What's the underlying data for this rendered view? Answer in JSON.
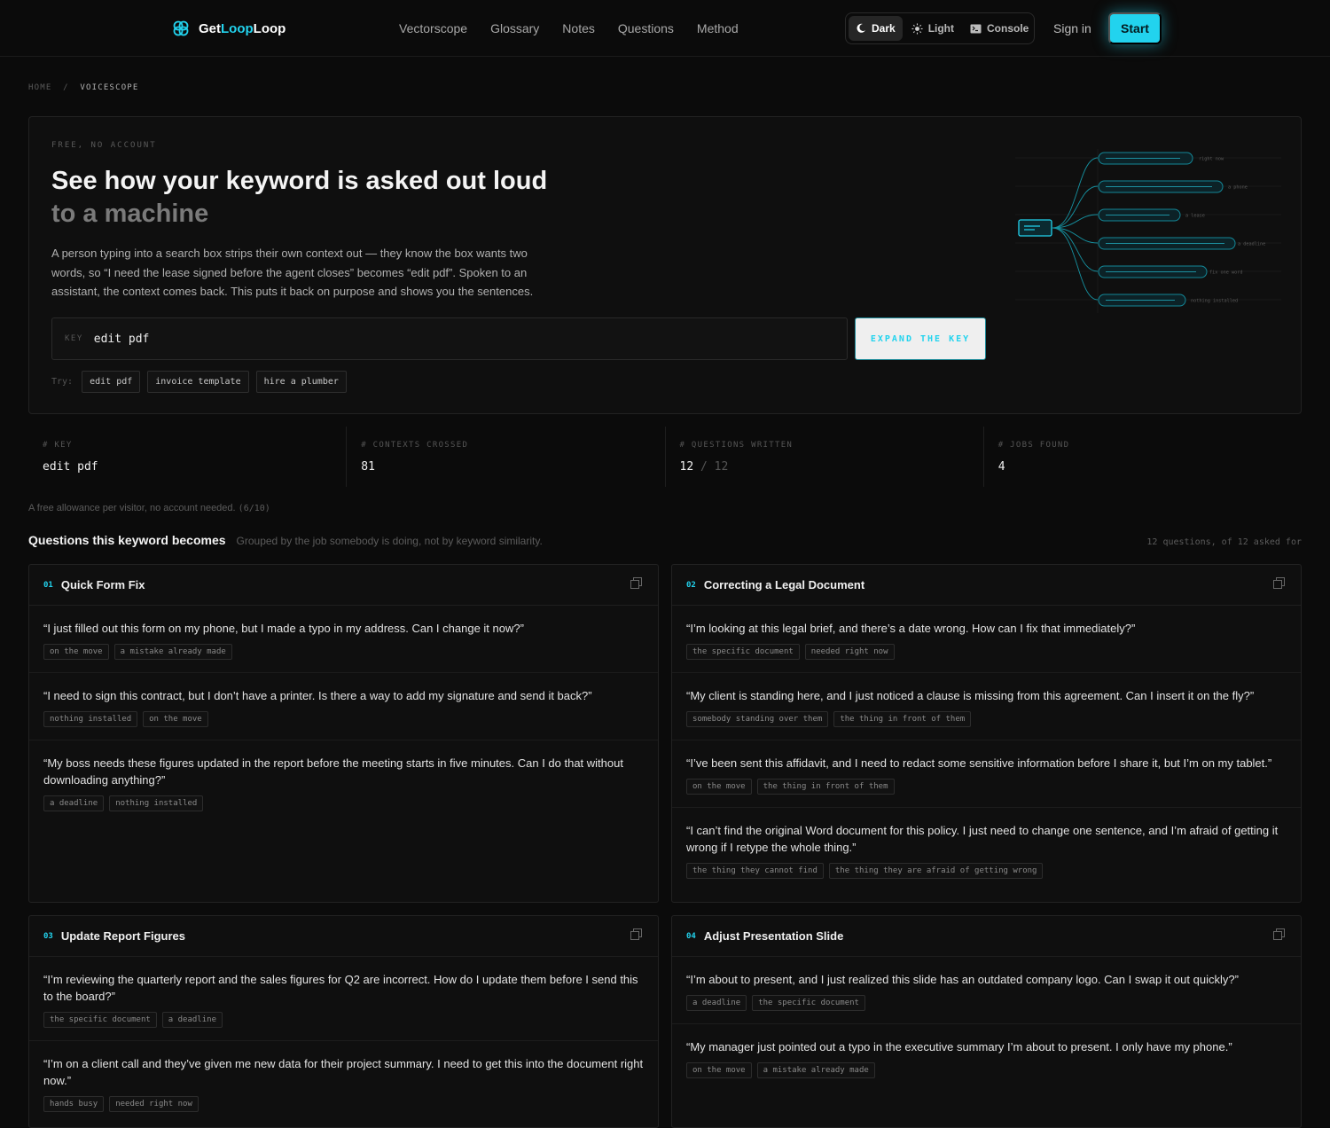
{
  "nav": {
    "brand_get": "Get",
    "brand_loop": "Loop",
    "brand_loop2": "Loop",
    "links": [
      "Vectorscope",
      "Glossary",
      "Notes",
      "Questions",
      "Method"
    ],
    "theme_dark": "Dark",
    "theme_light": "Light",
    "theme_console": "Console",
    "signin": "Sign in",
    "start": "Start"
  },
  "breadcrumb": {
    "home": "HOME",
    "sep": "/",
    "current": "VOICESCOPE"
  },
  "hero": {
    "eyebrow": "FREE, NO ACCOUNT",
    "title": "See how your keyword is asked out loud",
    "title_dim": "to a machine",
    "lede": "A person typing into a search box strips their own context out — they know the box wants two words, so “I need the lease signed before the agent closes” becomes “edit pdf”. Spoken to an assistant, the context comes back. This puts it back on purpose and shows you the sentences.",
    "key_label": "KEY",
    "key_value": "edit pdf",
    "expand": "EXPAND THE KEY",
    "try_label": "Try:",
    "try_chips": [
      "edit pdf",
      "invoice template",
      "hire a plumber"
    ],
    "viz_labels": [
      "right now",
      "a phone",
      "a lease",
      "a deadline",
      "fix one word",
      "nothing installed"
    ]
  },
  "stats": [
    {
      "label": "# KEY",
      "value": "edit pdf"
    },
    {
      "label": "# CONTEXTS CROSSED",
      "value": "81"
    },
    {
      "label": "# QUESTIONS WRITTEN",
      "value": "12",
      "sep": "/",
      "total": "12"
    },
    {
      "label": "# JOBS FOUND",
      "value": "4"
    }
  ],
  "allowance": {
    "text": "A free allowance per visitor, no account needed.",
    "count": "(6/10)"
  },
  "section": {
    "title": "Questions this keyword becomes",
    "subtitle": "Grouped by the job somebody is doing, not by keyword similarity.",
    "count": "12 questions, of 12 asked for"
  },
  "cards": [
    {
      "num": "01",
      "title": "Quick Form Fix",
      "questions": [
        {
          "text": "“I just filled out this form on my phone, but I made a typo in my address. Can I change it now?”",
          "tags": [
            "on the move",
            "a mistake already made"
          ]
        },
        {
          "text": "“I need to sign this contract, but I don’t have a printer. Is there a way to add my signature and send it back?”",
          "tags": [
            "nothing installed",
            "on the move"
          ]
        },
        {
          "text": "“My boss needs these figures updated in the report before the meeting starts in five minutes. Can I do that without downloading anything?”",
          "tags": [
            "a deadline",
            "nothing installed"
          ]
        }
      ]
    },
    {
      "num": "02",
      "title": "Correcting a Legal Document",
      "questions": [
        {
          "text": "“I’m looking at this legal brief, and there’s a date wrong. How can I fix that immediately?”",
          "tags": [
            "the specific document",
            "needed right now"
          ]
        },
        {
          "text": "“My client is standing here, and I just noticed a clause is missing from this agreement. Can I insert it on the fly?”",
          "tags": [
            "somebody standing over them",
            "the thing in front of them"
          ]
        },
        {
          "text": "“I’ve been sent this affidavit, and I need to redact some sensitive information before I share it, but I’m on my tablet.”",
          "tags": [
            "on the move",
            "the thing in front of them"
          ]
        },
        {
          "text": "“I can’t find the original Word document for this policy. I just need to change one sentence, and I’m afraid of getting it wrong if I retype the whole thing.”",
          "tags": [
            "the thing they cannot find",
            "the thing they are afraid of getting wrong"
          ]
        }
      ]
    },
    {
      "num": "03",
      "title": "Update Report Figures",
      "questions": [
        {
          "text": "“I’m reviewing the quarterly report and the sales figures for Q2 are incorrect. How do I update them before I send this to the board?”",
          "tags": [
            "the specific document",
            "a deadline"
          ]
        },
        {
          "text": "“I’m on a client call and they’ve given me new data for their project summary. I need to get this into the document right now.”",
          "tags": [
            "hands busy",
            "needed right now"
          ]
        }
      ]
    },
    {
      "num": "04",
      "title": "Adjust Presentation Slide",
      "questions": [
        {
          "text": "“I’m about to present, and I just realized this slide has an outdated company logo. Can I swap it out quickly?”",
          "tags": [
            "a deadline",
            "the specific document"
          ]
        },
        {
          "text": "“My manager just pointed out a typo in the executive summary I’m about to present. I only have my phone.”",
          "tags": [
            "on the move",
            "a mistake already made"
          ]
        }
      ]
    }
  ],
  "colors": {
    "accent": "#22d3ee",
    "bg": "#0b0b0b",
    "panel": "#0f0f0f"
  }
}
